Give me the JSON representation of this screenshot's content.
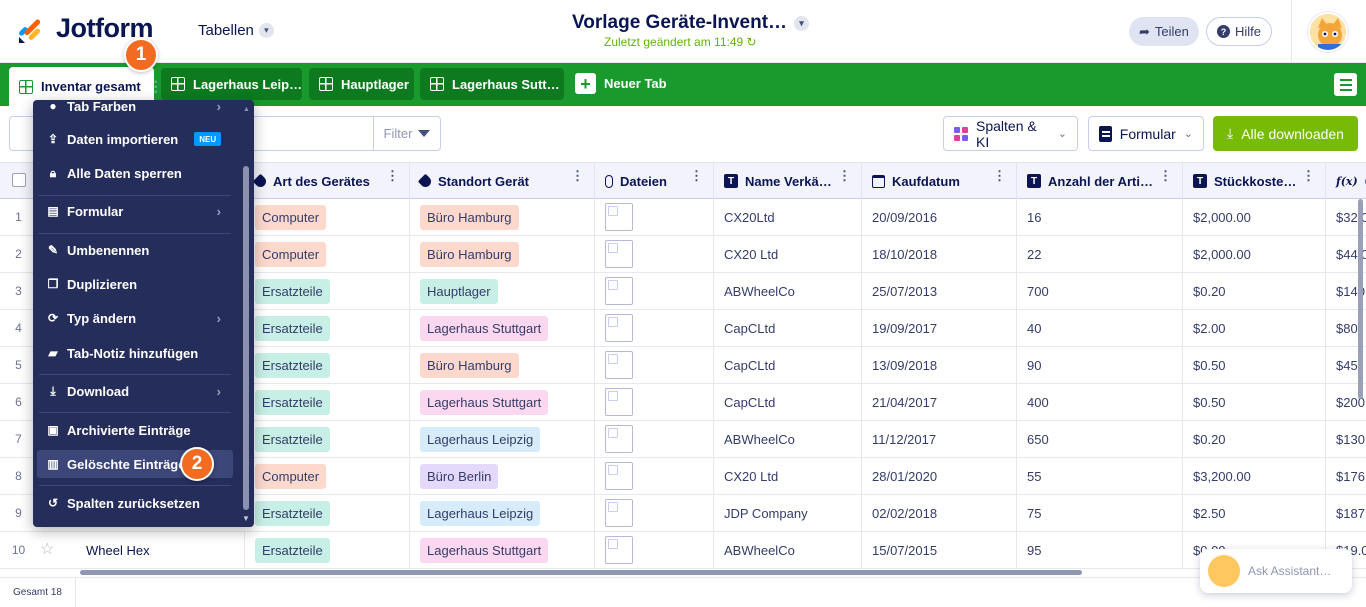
{
  "header": {
    "brand": "Jotform",
    "tables_label": "Tabellen",
    "title": "Vorlage Geräte-Invent…",
    "last_changed": "Zuletzt geändert am 11:49",
    "share_label": "Teilen",
    "help_label": "Hilfe"
  },
  "tabs": [
    {
      "label": "Inventar gesamt",
      "active": true
    },
    {
      "label": "Lagerhaus Leip…",
      "active": false
    },
    {
      "label": "Hauptlager",
      "active": false
    },
    {
      "label": "Lagerhaus Sutt…",
      "active": false
    }
  ],
  "new_tab_label": "Neuer Tab",
  "toolbar": {
    "filter_label": "Filter",
    "columns_ai_label": "Spalten & KI",
    "form_label": "Formular",
    "download_all_label": "Alle downloaden"
  },
  "columns": [
    "Art des Gerätes",
    "Standort Gerät",
    "Dateien",
    "Name Verkä…",
    "Kaufdatum",
    "Anzahl der Arti…",
    "Stückkoste…",
    "G"
  ],
  "rows": [
    {
      "num": "1",
      "type": "Computer",
      "location": "Büro Hamburg",
      "vendor": "CX20Ltd",
      "date": "20/09/2016",
      "qty": "16",
      "cost": "$2,000.00",
      "total": "$32,0"
    },
    {
      "num": "2",
      "type": "Computer",
      "location": "Büro Hamburg",
      "vendor": "CX20 Ltd",
      "date": "18/10/2018",
      "qty": "22",
      "cost": "$2,000.00",
      "total": "$44,0"
    },
    {
      "num": "3",
      "type": "Ersatzteile",
      "location": "Hauptlager",
      "vendor": "ABWheelCo",
      "date": "25/07/2013",
      "qty": "700",
      "cost": "$0.20",
      "total": "$140"
    },
    {
      "num": "4",
      "type": "Ersatzteile",
      "location": "Lagerhaus Stuttgart",
      "vendor": "CapCLtd",
      "date": "19/09/2017",
      "qty": "40",
      "cost": "$2.00",
      "total": "$80."
    },
    {
      "num": "5",
      "type": "Ersatzteile",
      "location": "Büro Hamburg",
      "vendor": "CapCLtd",
      "date": "13/09/2018",
      "qty": "90",
      "cost": "$0.50",
      "total": "$45."
    },
    {
      "num": "6",
      "type": "Ersatzteile",
      "location": "Lagerhaus Stuttgart",
      "vendor": "CapCLtd",
      "date": "21/04/2017",
      "qty": "400",
      "cost": "$0.50",
      "total": "$200"
    },
    {
      "num": "7",
      "type": "Ersatzteile",
      "location": "Lagerhaus Leipzig",
      "vendor": "ABWheelCo",
      "date": "11/12/2017",
      "qty": "650",
      "cost": "$0.20",
      "total": "$130"
    },
    {
      "num": "8",
      "type": "Computer",
      "location": "Büro Berlin",
      "vendor": "CX20 Ltd",
      "date": "28/01/2020",
      "qty": "55",
      "cost": "$3,200.00",
      "total": "$176,0"
    },
    {
      "num": "9",
      "type": "Ersatzteile",
      "location": "Lagerhaus Leipzig",
      "vendor": "JDP Company",
      "date": "02/02/2018",
      "qty": "75",
      "cost": "$2.50",
      "total": "$187.5"
    },
    {
      "num": "10",
      "name": "Wheel Hex",
      "type": "Ersatzteile",
      "location": "Lagerhaus Stuttgart",
      "vendor": "ABWheelCo",
      "date": "15/07/2015",
      "qty": "95",
      "cost": "$0.00",
      "total": "$19.0"
    }
  ],
  "pill_colors": {
    "Computer": "#fdd9cd",
    "Ersatzteile": "#c8efe6",
    "Büro Hamburg": "#fdd9cd",
    "Hauptlager": "#c8efe6",
    "Lagerhaus Stuttgart": "#fbd8ef",
    "Lagerhaus Leipzig": "#d6ecfb",
    "Büro Berlin": "#e4d9fb"
  },
  "menu": {
    "items": [
      {
        "label": "Tab Farben",
        "icon": "circle-icon"
      },
      {
        "label": "Daten importieren",
        "icon": "upload-icon",
        "badge": "NEU"
      },
      {
        "label": "Alle Daten sperren",
        "icon": "lock-icon"
      },
      {
        "label": "Formular",
        "icon": "form-icon"
      },
      {
        "label": "Umbenennen",
        "icon": "edit-icon"
      },
      {
        "label": "Duplizieren",
        "icon": "duplicate-icon"
      },
      {
        "label": "Typ ändern",
        "icon": "refresh-icon"
      },
      {
        "label": "Tab-Notiz hinzufügen",
        "icon": "note-icon"
      },
      {
        "label": "Download",
        "icon": "download-icon"
      },
      {
        "label": "Archivierte Einträge",
        "icon": "archive-icon"
      },
      {
        "label": "Gelöschte Einträge",
        "icon": "trash-icon"
      },
      {
        "label": "Spalten zurücksetzen",
        "icon": "reset-icon"
      }
    ]
  },
  "markers": {
    "one": "1",
    "two": "2"
  },
  "footer": {
    "total": "Gesamt 18"
  },
  "assistant": {
    "label": "Ask Assistant…"
  }
}
